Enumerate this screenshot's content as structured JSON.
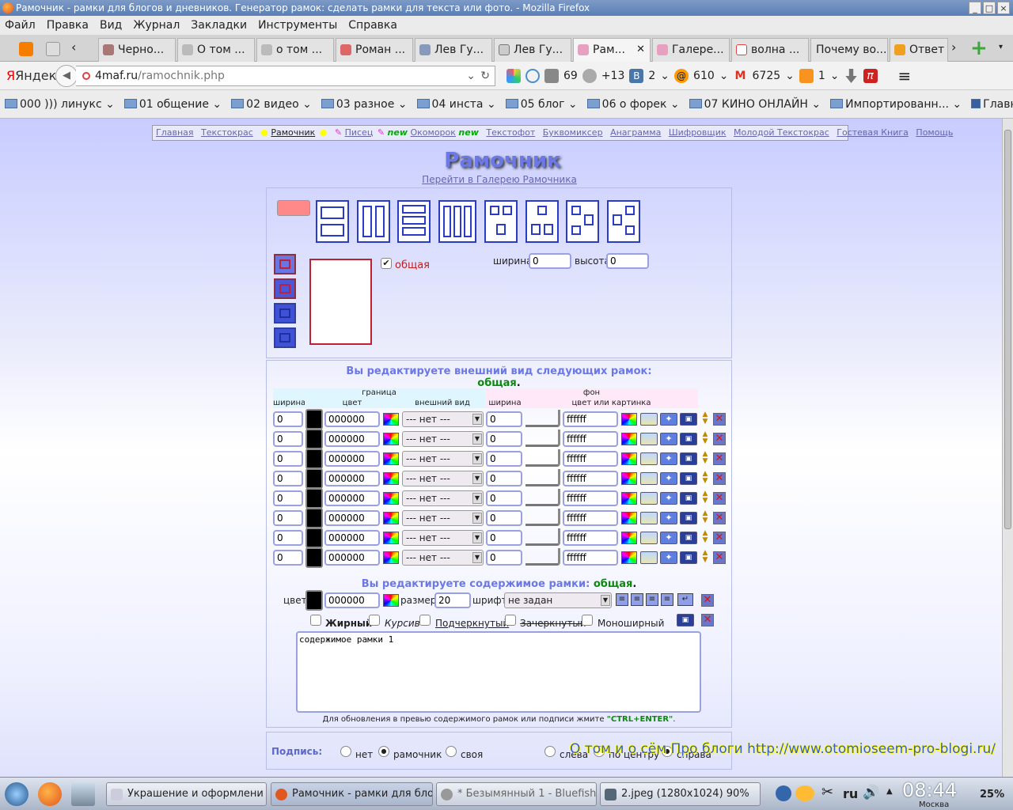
{
  "window": {
    "title": "Рамочник - рамки для блогов и дневников. Генератор рамок: сделать рамки для текста или фото. - Mozilla Firefox"
  },
  "menu": [
    "Файл",
    "Правка",
    "Вид",
    "Журнал",
    "Закладки",
    "Инструменты",
    "Справка"
  ],
  "tabs": [
    {
      "label": "Черно...",
      "active": false
    },
    {
      "label": "О том ...",
      "active": false
    },
    {
      "label": "о том ...",
      "active": false
    },
    {
      "label": "Роман ...",
      "active": false
    },
    {
      "label": "Лев Гу...",
      "active": false
    },
    {
      "label": "Лев Гу...",
      "active": false
    },
    {
      "label": "Рам...",
      "active": true
    },
    {
      "label": "Галере...",
      "active": false
    },
    {
      "label": "волна ...",
      "active": false
    },
    {
      "label": "Почему во...",
      "active": false
    },
    {
      "label": "Ответ",
      "active": false
    }
  ],
  "nav": {
    "brand": "Яндекс",
    "url_domain": "4maf.ru",
    "url_path": "/ramochnik.php",
    "counters": {
      "mail": "69",
      "weather": "+13",
      "vk": "2",
      "mailru": "610",
      "gmail": "6725",
      "ok": "1"
    }
  },
  "bookmarks": [
    "000 ))) линукс",
    "01 общение",
    "02 видео",
    "03 разное",
    "04 инста",
    "05 блог",
    "06 о форек",
    "07 КИНО ОНЛАЙН",
    "Импортированн...",
    "Главная"
  ],
  "site": {
    "nav": [
      "Главная",
      "Текстокрас",
      "Рамочник",
      "Писец",
      "new",
      "Окоморок",
      "new",
      "Текстофот",
      "Буквомиксер",
      "Анаграмма",
      "Шифровщик",
      "Молодой Текстокрас",
      "Гостевая Книга",
      "Помощь"
    ],
    "logo": "Рамочник",
    "gallery_link": "Перейти в Галерею Рамочника",
    "general_label": "общая",
    "width_label": "ширина",
    "height_label": "высота",
    "width_value": "0",
    "height_value": "0",
    "edit_title": "Вы редактируете внешний вид следующих рамок:",
    "edit_name": "общая",
    "border_header": "граница",
    "bg_header": "фон",
    "col_width": "ширина",
    "col_color": "цвет",
    "col_look": "внешний вид",
    "col_bgwidth": "ширина",
    "col_bgcolor": "цвет или картинка",
    "rows": [
      {
        "width": "0",
        "color": "000000",
        "style": "--- нет ---",
        "bgwidth": "0",
        "bgcolor": "ffffff"
      },
      {
        "width": "0",
        "color": "000000",
        "style": "--- нет ---",
        "bgwidth": "0",
        "bgcolor": "ffffff"
      },
      {
        "width": "0",
        "color": "000000",
        "style": "--- нет ---",
        "bgwidth": "0",
        "bgcolor": "ffffff"
      },
      {
        "width": "0",
        "color": "000000",
        "style": "--- нет ---",
        "bgwidth": "0",
        "bgcolor": "ffffff"
      },
      {
        "width": "0",
        "color": "000000",
        "style": "--- нет ---",
        "bgwidth": "0",
        "bgcolor": "ffffff"
      },
      {
        "width": "0",
        "color": "000000",
        "style": "--- нет ---",
        "bgwidth": "0",
        "bgcolor": "ffffff"
      },
      {
        "width": "0",
        "color": "000000",
        "style": "--- нет ---",
        "bgwidth": "0",
        "bgcolor": "ffffff"
      },
      {
        "width": "0",
        "color": "000000",
        "style": "--- нет ---",
        "bgwidth": "0",
        "bgcolor": "ffffff"
      }
    ],
    "content_title": "Вы редактируете содержимое рамки:",
    "content_name": "общая",
    "color_label": "цвет",
    "content_color": "000000",
    "size_label": "размер",
    "size_value": "20",
    "font_label": "шрифт",
    "font_value": "не задан",
    "styles": {
      "bold": "Жирный",
      "italic": "Курсив",
      "underline": "Подчеркнутый",
      "strike": "Зачеркнутый",
      "mono": "Моноширный"
    },
    "textarea": "содержимое рамки 1",
    "hint_prefix": "Для обновления в превью содержимого рамок или подписи жмите ",
    "hint_key": "\"CTRL+ENTER\"",
    "hint_suffix": ".",
    "signature_label": "Подпись:",
    "sig_options": [
      "нет",
      "рамочник",
      "своя"
    ],
    "sig_align": [
      "слева",
      "по центру",
      "справа"
    ],
    "watermark": "О том и о сём Про блоги http://www.otomioseem-pro-blogi.ru/"
  },
  "taskbar": {
    "items": [
      {
        "label": "Украшение и оформлени",
        "active": false
      },
      {
        "label": "Рамочник - рамки для бло",
        "active": true
      },
      {
        "label": "* Безымянный 1 - Bluefish",
        "active": false
      },
      {
        "label": "2.jpeg (1280x1024) 90%",
        "active": false
      }
    ],
    "lang": "ru",
    "time": "08:44",
    "city": "Москва",
    "battery": "25%"
  },
  "colors": {
    "accent": "#6b78e6",
    "green": "#0a8a0a",
    "frame_red": "#c02030"
  }
}
